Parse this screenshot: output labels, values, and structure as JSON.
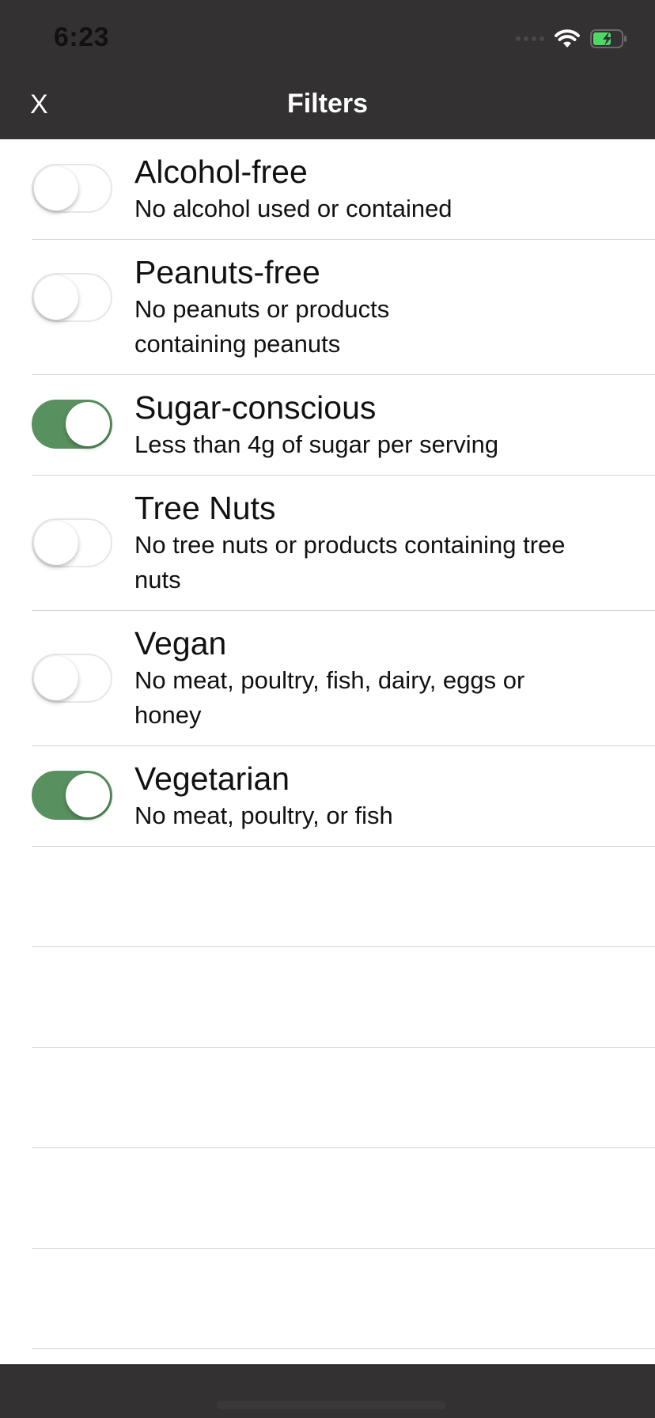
{
  "status_bar": {
    "time": "6:23",
    "battery_color": "#4cd964"
  },
  "nav": {
    "close_label": "X",
    "title": "Filters"
  },
  "colors": {
    "bar_background": "#333131",
    "toggle_on": "#58905f"
  },
  "filters": [
    {
      "title": "Alcohol-free",
      "subtitle": "No alcohol used or contained",
      "enabled": false
    },
    {
      "title": "Peanuts-free",
      "subtitle": "No peanuts or products containing peanuts",
      "enabled": false
    },
    {
      "title": "Sugar-conscious",
      "subtitle": "Less than 4g of sugar per serving",
      "enabled": true
    },
    {
      "title": "Tree Nuts",
      "subtitle": "No tree nuts or products containing tree nuts",
      "enabled": false
    },
    {
      "title": "Vegan",
      "subtitle": "No meat, poultry, fish, dairy, eggs or honey",
      "enabled": false
    },
    {
      "title": "Vegetarian",
      "subtitle": "No meat, poultry, or fish",
      "enabled": true
    }
  ]
}
